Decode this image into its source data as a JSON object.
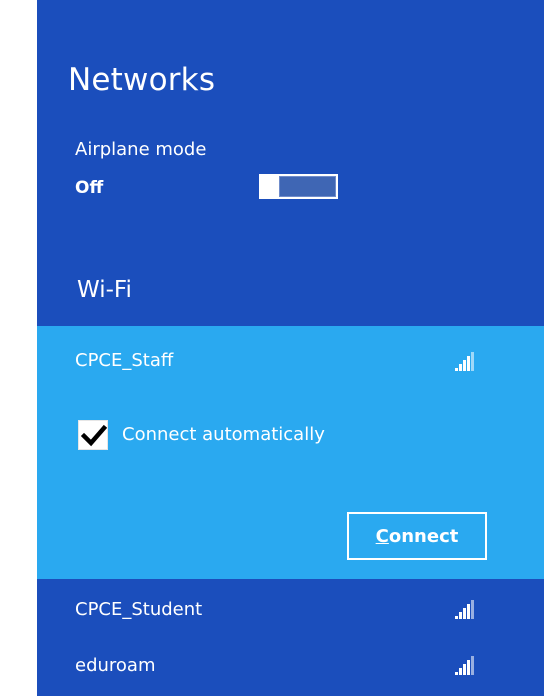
{
  "panel": {
    "title": "Networks",
    "background_color": "#1b4ebc",
    "selected_color": "#2aa9f0"
  },
  "airplane": {
    "label": "Airplane mode",
    "state": "Off",
    "on": false
  },
  "wifi": {
    "heading": "Wi-Fi",
    "selected_network": {
      "name": "CPCE_Staff",
      "signal_icon": "signal-strength-icon",
      "connect_automatically_label": "Connect automatically",
      "connect_automatically_checked": true,
      "connect_button_first": "C",
      "connect_button_rest": "onnect"
    },
    "networks": [
      {
        "name": "CPCE_Student",
        "signal_icon": "signal-strength-icon"
      },
      {
        "name": "eduroam",
        "signal_icon": "signal-strength-icon"
      }
    ]
  }
}
